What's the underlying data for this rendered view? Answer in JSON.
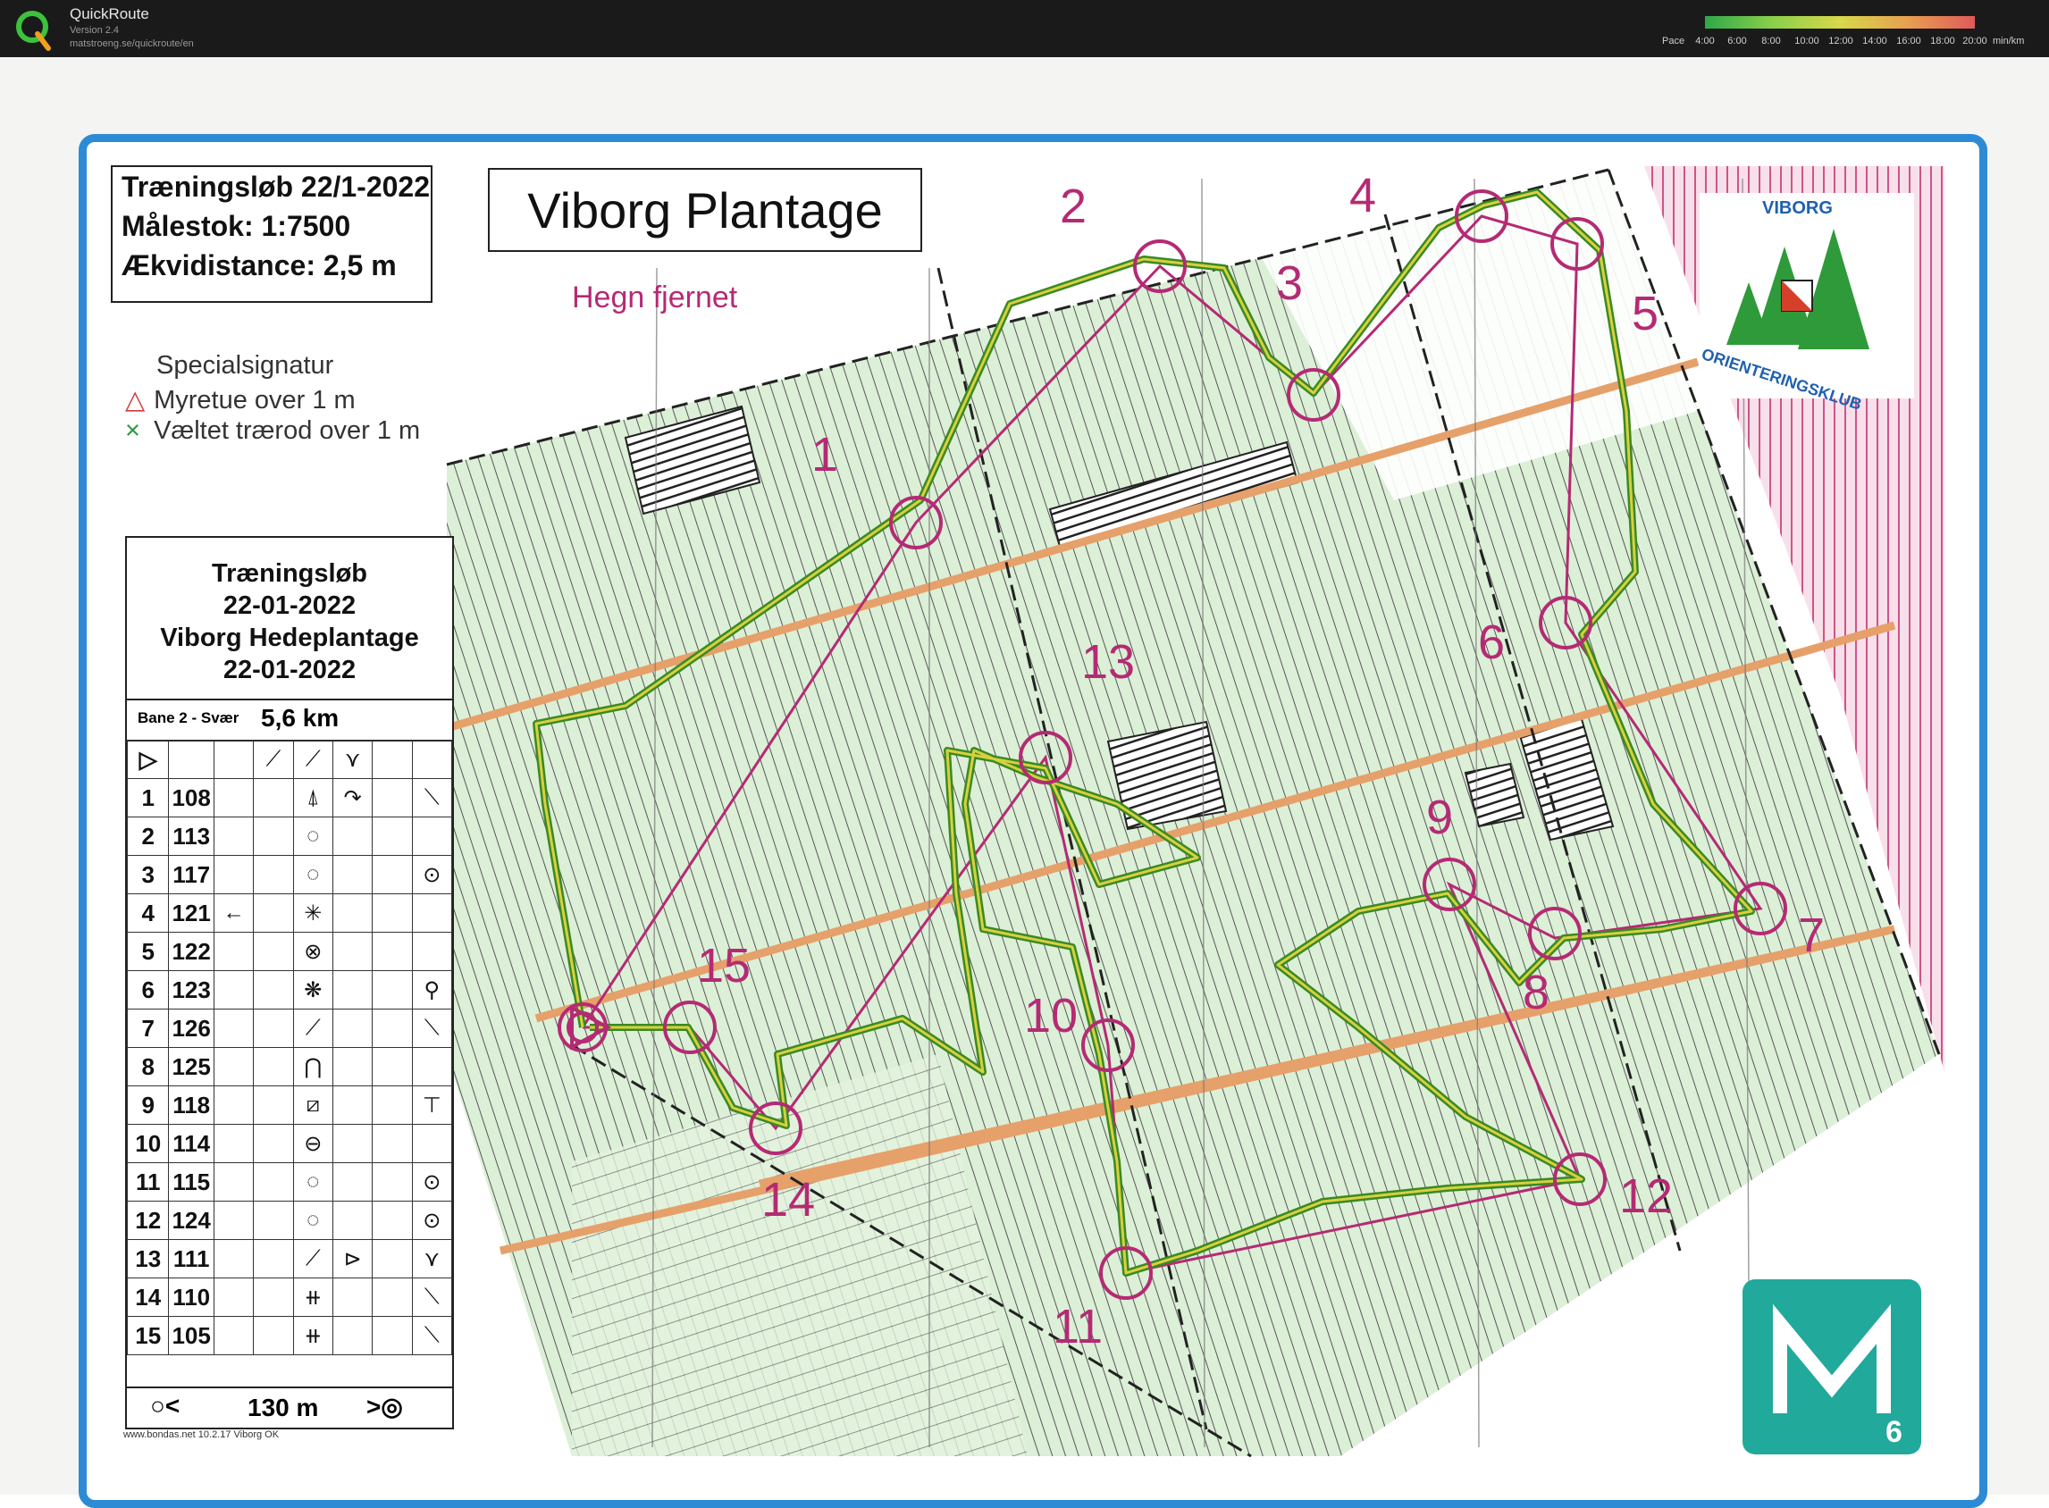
{
  "app": {
    "name": "QuickRoute",
    "version": "Version 2.4",
    "url": "matstroeng.se/quickroute/en"
  },
  "pace_legend": {
    "label": "Pace",
    "ticks": [
      "4:00",
      "6:00",
      "8:00",
      "10:00",
      "12:00",
      "14:00",
      "16:00",
      "18:00",
      "20:00"
    ],
    "unit": "min/km"
  },
  "map": {
    "info": {
      "line1": "Træningsløb 22/1-2022",
      "line2": "Målestok: 1:7500",
      "line3": "Ækvidistance: 2,5 m"
    },
    "title": "Viborg Plantage",
    "annotation": "Hegn fjernet",
    "legend": {
      "title": "Specialsignatur",
      "item1_symbol": "△",
      "item1_label": "Myretue over 1 m",
      "item2_symbol": "×",
      "item2_label": "Væltet trærod over 1 m"
    },
    "controls": [
      "1",
      "2",
      "3",
      "4",
      "5",
      "6",
      "7",
      "8",
      "9",
      "10",
      "11",
      "12",
      "13",
      "14",
      "15"
    ],
    "club_logo": {
      "top_text": "VIBORG",
      "bottom_text": "ORIENTERINGSKLUB"
    },
    "corner_badge": "M6",
    "credit": "www.bondas.net 10.2.17 Viborg OK"
  },
  "description_sheet": {
    "title1": "Træningsløb",
    "title2": "22-01-2022",
    "title3": "Viborg Hedeplantage",
    "title4": "22-01-2022",
    "course": "Bane 2 - Svær",
    "length": "5,6 km",
    "start_symbol": "▷",
    "rows": [
      {
        "num": "1",
        "code": "108",
        "c": "",
        "d": "",
        "e": "⍋",
        "f": "↷",
        "g": "⟍"
      },
      {
        "num": "2",
        "code": "113",
        "c": "",
        "d": "",
        "e": "◌",
        "f": "",
        "g": ""
      },
      {
        "num": "3",
        "code": "117",
        "c": "",
        "d": "",
        "e": "◌",
        "f": "",
        "g": "⊙"
      },
      {
        "num": "4",
        "code": "121",
        "c": "←",
        "d": "",
        "e": "✳",
        "f": "",
        "g": ""
      },
      {
        "num": "5",
        "code": "122",
        "c": "",
        "d": "",
        "e": "⊗",
        "f": "",
        "g": ""
      },
      {
        "num": "6",
        "code": "123",
        "c": "",
        "d": "",
        "e": "❋",
        "f": "",
        "g": "⚲"
      },
      {
        "num": "7",
        "code": "126",
        "c": "",
        "d": "",
        "e": "⟋",
        "f": "",
        "g": "⟍"
      },
      {
        "num": "8",
        "code": "125",
        "c": "",
        "d": "",
        "e": "⋂",
        "f": "",
        "g": ""
      },
      {
        "num": "9",
        "code": "118",
        "c": "",
        "d": "",
        "e": "⧄",
        "f": "",
        "g": "⊤"
      },
      {
        "num": "10",
        "code": "114",
        "c": "",
        "d": "",
        "e": "⊖",
        "f": "",
        "g": ""
      },
      {
        "num": "11",
        "code": "115",
        "c": "",
        "d": "",
        "e": "◌",
        "f": "",
        "g": "⊙"
      },
      {
        "num": "12",
        "code": "124",
        "c": "",
        "d": "",
        "e": "◌",
        "f": "",
        "g": "⊙"
      },
      {
        "num": "13",
        "code": "111",
        "c": "",
        "d": "",
        "e": "⟋",
        "f": "⊳",
        "g": "⋎"
      },
      {
        "num": "14",
        "code": "110",
        "c": "",
        "d": "",
        "e": "⧺",
        "f": "",
        "g": "⟍"
      },
      {
        "num": "15",
        "code": "105",
        "c": "",
        "d": "",
        "e": "⧺",
        "f": "",
        "g": "⟍"
      }
    ],
    "start_row_symbols": {
      "e": "⟋",
      "f": "⟋",
      "g": "⋎"
    },
    "finish": {
      "left_symbol": "○<",
      "distance": "130 m",
      "right_symbol": ">◎"
    }
  },
  "colors": {
    "frame_blue": "#2d8bd6",
    "course_magenta": "#b52a74",
    "route_green": "#4a9a2a",
    "route_yellow": "#d8d040",
    "forest_green": "#cfe8c6",
    "road_orange": "#e8a070"
  }
}
